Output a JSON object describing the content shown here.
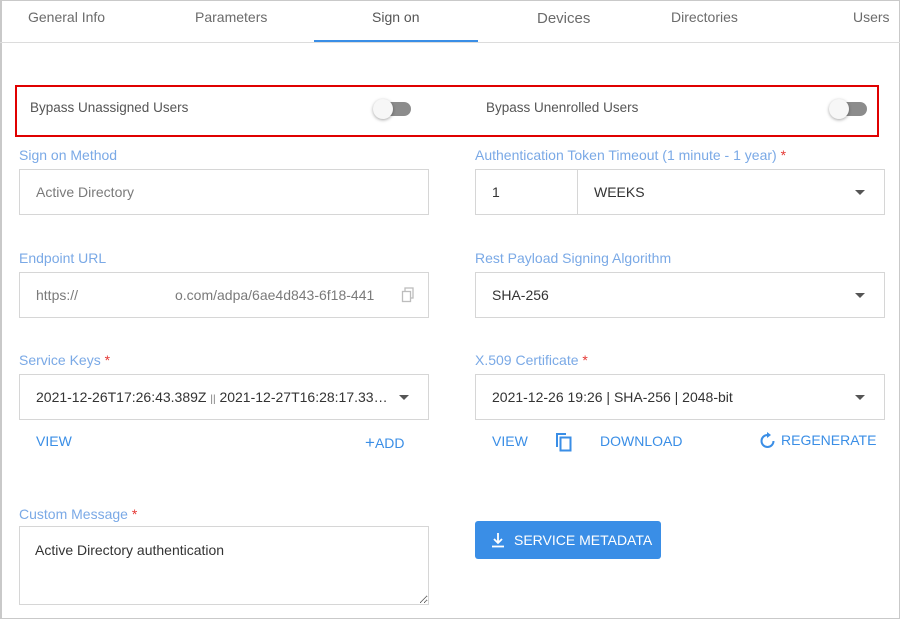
{
  "tabs": [
    {
      "label": "General Info",
      "active": false
    },
    {
      "label": "Parameters",
      "active": false
    },
    {
      "label": "Sign on",
      "active": true
    },
    {
      "label": "Devices",
      "active": false
    },
    {
      "label": "Directories",
      "active": false
    },
    {
      "label": "Users",
      "active": false
    }
  ],
  "toggles": {
    "bypass_unassigned": {
      "label": "Bypass Unassigned Users",
      "on": false
    },
    "bypass_unenrolled": {
      "label": "Bypass Unenrolled Users",
      "on": false
    }
  },
  "sign_on_method": {
    "label": "Sign on Method",
    "value": "Active Directory"
  },
  "auth_token_timeout": {
    "label": "Authentication Token Timeout (1 minute - 1 year)",
    "required": "*",
    "amount": "1",
    "unit": "WEEKS"
  },
  "endpoint_url": {
    "label": "Endpoint URL",
    "value_start": "https://",
    "value_end": "o.com/adpa/6ae4d843-6f18-441"
  },
  "rest_signing": {
    "label": "Rest Payload Signing Algorithm",
    "value": "SHA-256"
  },
  "service_keys": {
    "label": "Service Keys",
    "required": "*",
    "value": "2021-12-26T17:26:43.389Z",
    "separator": "||",
    "value2": "2021-12-27T16:28:17.33…",
    "view": "VIEW",
    "add": "ADD"
  },
  "x509": {
    "label": "X.509 Certificate",
    "required": "*",
    "value": "2021-12-26 19:26 | SHA-256 | 2048-bit",
    "view": "VIEW",
    "download": "DOWNLOAD",
    "regenerate": "REGENERATE"
  },
  "custom_message": {
    "label": "Custom Message",
    "required": "*",
    "value": "Active Directory authentication"
  },
  "service_metadata_button": "SERVICE METADATA",
  "colors": {
    "accent": "#3a8ee6",
    "label": "#7aa9e6",
    "required": "#e53935",
    "highlight": "#e00000",
    "toggle_off": "#8c8c8c"
  }
}
